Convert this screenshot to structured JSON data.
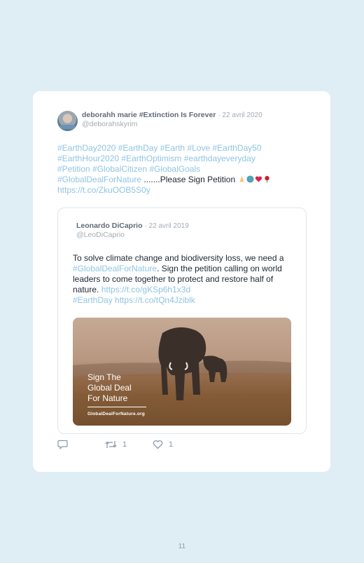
{
  "tweet": {
    "author_name": "deborahh marie #Extinction Is Forever",
    "date": "· 22 avril 2020",
    "handle": "@deborahskyrim",
    "hashtags_line1": "#EarthDay2020 #EarthDay #Earth #Love #EarthDay50",
    "hashtags_line2": "#EarthHour2020 #EarthOptimism #earthdayeveryday",
    "hashtags_line3": "#Petition #GlobalCitizen #GlobalGoals",
    "hashtag_line4": "#GlobalDealForNature",
    "plain_text": " .......Please Sign Petition ",
    "link": "https://t.co/ZkuOOB5S0y"
  },
  "quoted": {
    "author_name": "Leonardo DiCaprio",
    "date": "· 22 avril 2019",
    "handle": "@LeoDiCaprio",
    "text_1": "To solve climate change and biodiversity loss, we need a ",
    "hashtag_1": "#GlobalDealForNature",
    "text_2": ". Sign the petition calling on world leaders to come together to protect and restore half of nature. ",
    "link_1": "https://t.co/gKSp6h1x3d",
    "hashtag_2": "#EarthDay",
    "link_2": "https://t.co/tQn4Jziblk",
    "media_title_1": "Sign The",
    "media_title_2": "Global Deal",
    "media_title_3": "For Nature",
    "media_url": "GlobalDealForNature.org"
  },
  "actions": {
    "retweet_count": "1",
    "like_count": "1"
  },
  "page": {
    "number": "11"
  },
  "colors": {
    "background": "#dfedf5",
    "link": "#8fc4e4",
    "muted": "#a3acb4"
  }
}
